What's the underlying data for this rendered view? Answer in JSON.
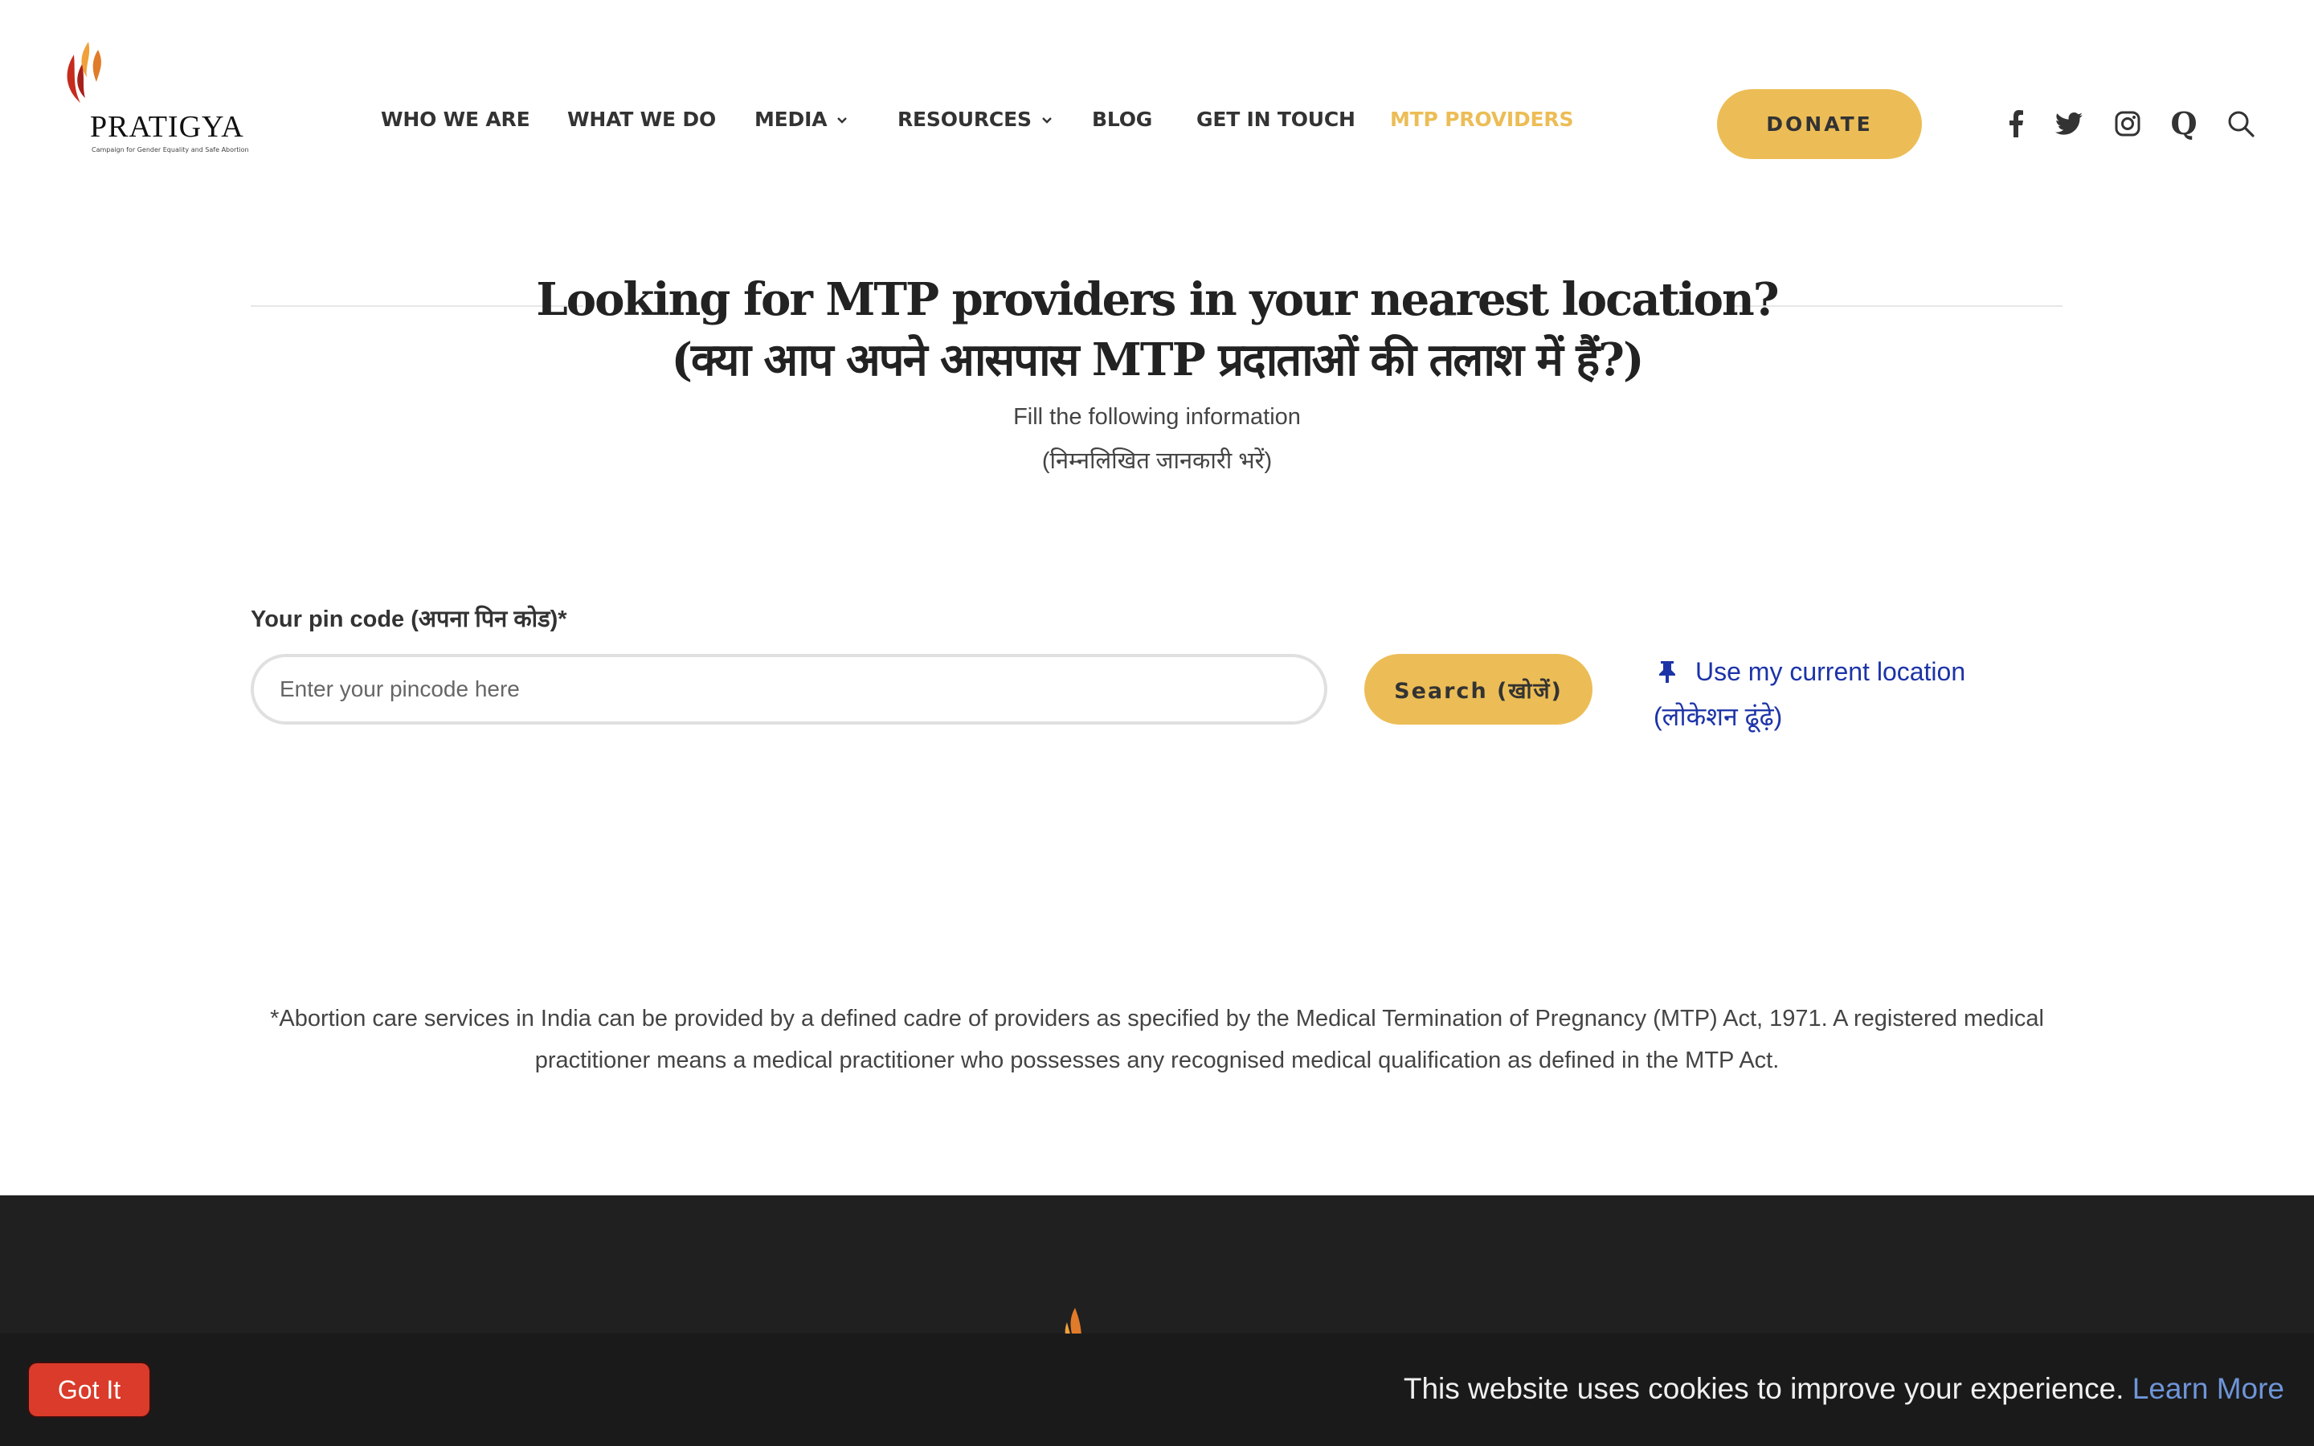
{
  "brand": {
    "name": "PRATIGYA",
    "tagline": "Campaign for Gender Equality and Safe Abortion"
  },
  "nav": {
    "items": [
      {
        "label": "WHO WE ARE"
      },
      {
        "label": "WHAT WE DO"
      },
      {
        "label": "MEDIA",
        "has_dropdown": true
      },
      {
        "label": "RESOURCES",
        "has_dropdown": true
      },
      {
        "label": "BLOG"
      },
      {
        "label": "GET IN TOUCH"
      },
      {
        "label": "MTP PROVIDERS",
        "active": true
      }
    ],
    "donate_label": "DONATE",
    "social_icons": [
      "facebook-icon",
      "twitter-icon",
      "instagram-icon",
      "quora-icon",
      "search-icon"
    ]
  },
  "hero": {
    "title_en": "Looking for MTP providers in your nearest location?",
    "title_hi": "(क्या आप अपने आसपास MTP प्रदाताओं की तलाश में हैं?)",
    "subtitle_en": "Fill the following information",
    "subtitle_hi": "(निम्नलिखित जानकारी भरें)"
  },
  "form": {
    "pin_label": "Your pin code (अपना पिन कोड)*",
    "pin_value": "",
    "pin_placeholder": "Enter your pincode here",
    "search_label": "Search (खोजें)",
    "location_line1": "Use my current location",
    "location_line2": "(लोकेशन ढूंढ़े)"
  },
  "note": "*Abortion care services in India can be provided by a defined cadre of providers as specified by the Medical Termination of Pregnancy (MTP) Act, 1971. A registered medical practitioner means a medical practitioner who possesses any recognised medical qualification as defined in the MTP Act.",
  "cookie": {
    "button_label": "Got It",
    "message": "This website uses cookies to improve your experience.",
    "link_label": "Learn More"
  },
  "colors": {
    "accent": "#ecbd56",
    "link": "#1c33a8",
    "footer": "#202020",
    "cookie_button": "#da3b2a",
    "cookie_link": "#6e95d8"
  }
}
